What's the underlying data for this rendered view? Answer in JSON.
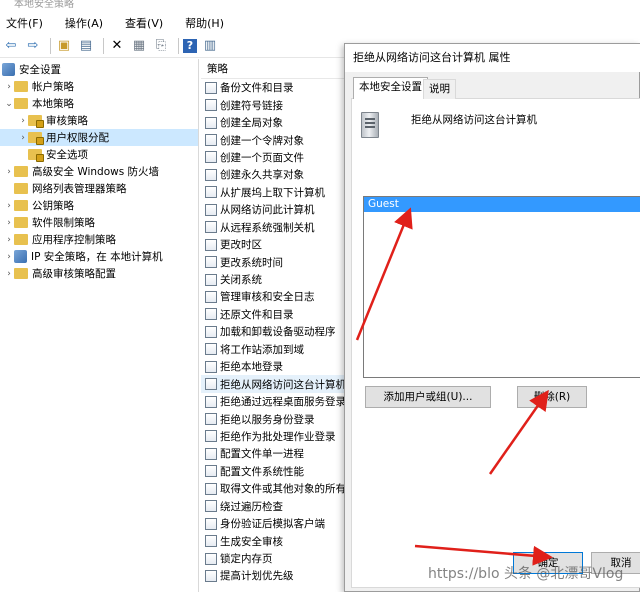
{
  "window": {
    "title": "本地安全策略"
  },
  "menu": [
    "文件(F)",
    "操作(A)",
    "查看(V)",
    "帮助(H)"
  ],
  "toolbar_icons": [
    "back-arrow-icon",
    "forward-arrow-icon",
    "up-folder-icon",
    "show-tree-icon",
    "delete-icon",
    "properties-icon",
    "export-list-icon",
    "help-icon",
    "view-icon"
  ],
  "tree": {
    "items": [
      {
        "label": "安全设置",
        "arrow": "",
        "icon": "shield"
      },
      {
        "label": "帐户策略",
        "arrow": "›",
        "icon": "folder"
      },
      {
        "label": "本地策略",
        "arrow": "⌄",
        "icon": "folder"
      },
      {
        "label": "审核策略",
        "arrow": "›",
        "icon": "folder-lock"
      },
      {
        "label": "用户权限分配",
        "arrow": "›",
        "icon": "folder-lock"
      },
      {
        "label": "安全选项",
        "arrow": "",
        "icon": "folder-lock"
      },
      {
        "label": "高级安全 Windows 防火墙",
        "arrow": "›",
        "icon": "folder"
      },
      {
        "label": "网络列表管理器策略",
        "arrow": "",
        "icon": "folder"
      },
      {
        "label": "公钥策略",
        "arrow": "›",
        "icon": "folder"
      },
      {
        "label": "软件限制策略",
        "arrow": "›",
        "icon": "folder"
      },
      {
        "label": "应用程序控制策略",
        "arrow": "›",
        "icon": "folder"
      },
      {
        "label": "IP 安全策略，在 本地计算机",
        "arrow": "›",
        "icon": "shield"
      },
      {
        "label": "高级审核策略配置",
        "arrow": "›",
        "icon": "folder"
      }
    ]
  },
  "policy_list": {
    "header": "策略",
    "items": [
      "备份文件和目录",
      "创建符号链接",
      "创建全局对象",
      "创建一个令牌对象",
      "创建一个页面文件",
      "创建永久共享对象",
      "从扩展坞上取下计算机",
      "从网络访问此计算机",
      "从远程系统强制关机",
      "更改时区",
      "更改系统时间",
      "关闭系统",
      "管理审核和安全日志",
      "还原文件和目录",
      "加载和卸载设备驱动程序",
      "将工作站添加到域",
      "拒绝本地登录",
      "拒绝从网络访问这台计算机",
      "拒绝通过远程桌面服务登录",
      "拒绝以服务身份登录",
      "拒绝作为批处理作业登录",
      "配置文件单一进程",
      "配置文件系统性能",
      "取得文件或其他对象的所有权",
      "绕过遍历检查",
      "身份验证后模拟客户端",
      "生成安全审核",
      "锁定内存页",
      "提高计划优先级"
    ]
  },
  "dialog": {
    "title": "拒绝从网络访问这台计算机 属性",
    "tabs": [
      "本地安全设置",
      "说明"
    ],
    "policy_name": "拒绝从网络访问这台计算机",
    "users": [
      "Guest"
    ],
    "add_button": "添加用户或组(U)...",
    "delete_button": "删除(R)",
    "ok_button": "确定",
    "cancel_button": "取消"
  },
  "watermark": "https://blo 头条 @北漂哥Vlog"
}
